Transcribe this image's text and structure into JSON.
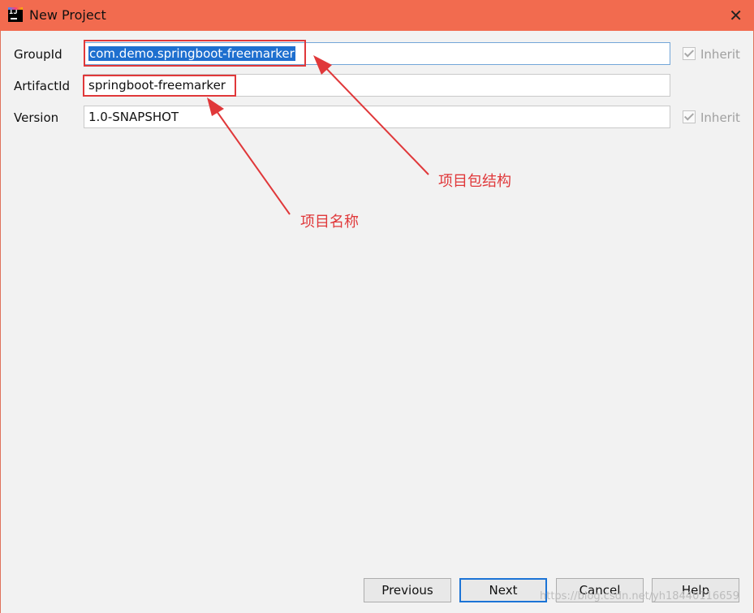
{
  "window": {
    "title": "New Project",
    "icon": "intellij-icon",
    "close_glyph": "✕"
  },
  "fields": {
    "group_id": {
      "label": "GroupId",
      "value": "com.demo.springboot-freemarker",
      "inherit_label": "Inherit",
      "inherit_checked": true
    },
    "artifact_id": {
      "label": "ArtifactId",
      "value": "springboot-freemarker"
    },
    "version": {
      "label": "Version",
      "value": "1.0-SNAPSHOT",
      "inherit_label": "Inherit",
      "inherit_checked": true
    }
  },
  "annotations": {
    "package_structure": "项目包结构",
    "project_name": "项目名称",
    "color": "#e0383a"
  },
  "buttons": {
    "previous": "Previous",
    "next": "Next",
    "cancel": "Cancel",
    "help": "Help"
  },
  "watermark": "https://blog.csdn.net/yh18440116659"
}
